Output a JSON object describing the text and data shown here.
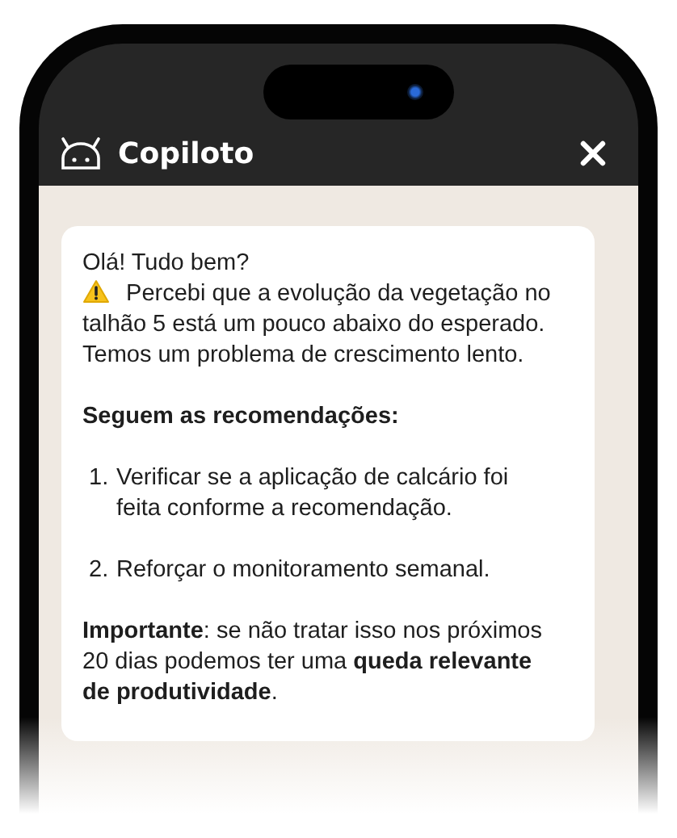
{
  "header": {
    "title": "Copiloto"
  },
  "message": {
    "greeting": "Olá! Tudo bem?",
    "alert": "Percebi que a evolução da vegetação no talhão 5 está um pouco abaixo do esperado. Temos um problema de crescimento lento.",
    "heading": "Seguem as recomendações:",
    "recommendations": [
      {
        "number": "1.",
        "text": "Verificar se a aplicação de calcário foi feita conforme a recomendação."
      },
      {
        "number": "2.",
        "text": "Reforçar o monitoramento semanal."
      }
    ],
    "note": "**Importante**: se não tratar isso nos próximos 20 dias podemos ter uma **queda relevante de produtividade**."
  }
}
